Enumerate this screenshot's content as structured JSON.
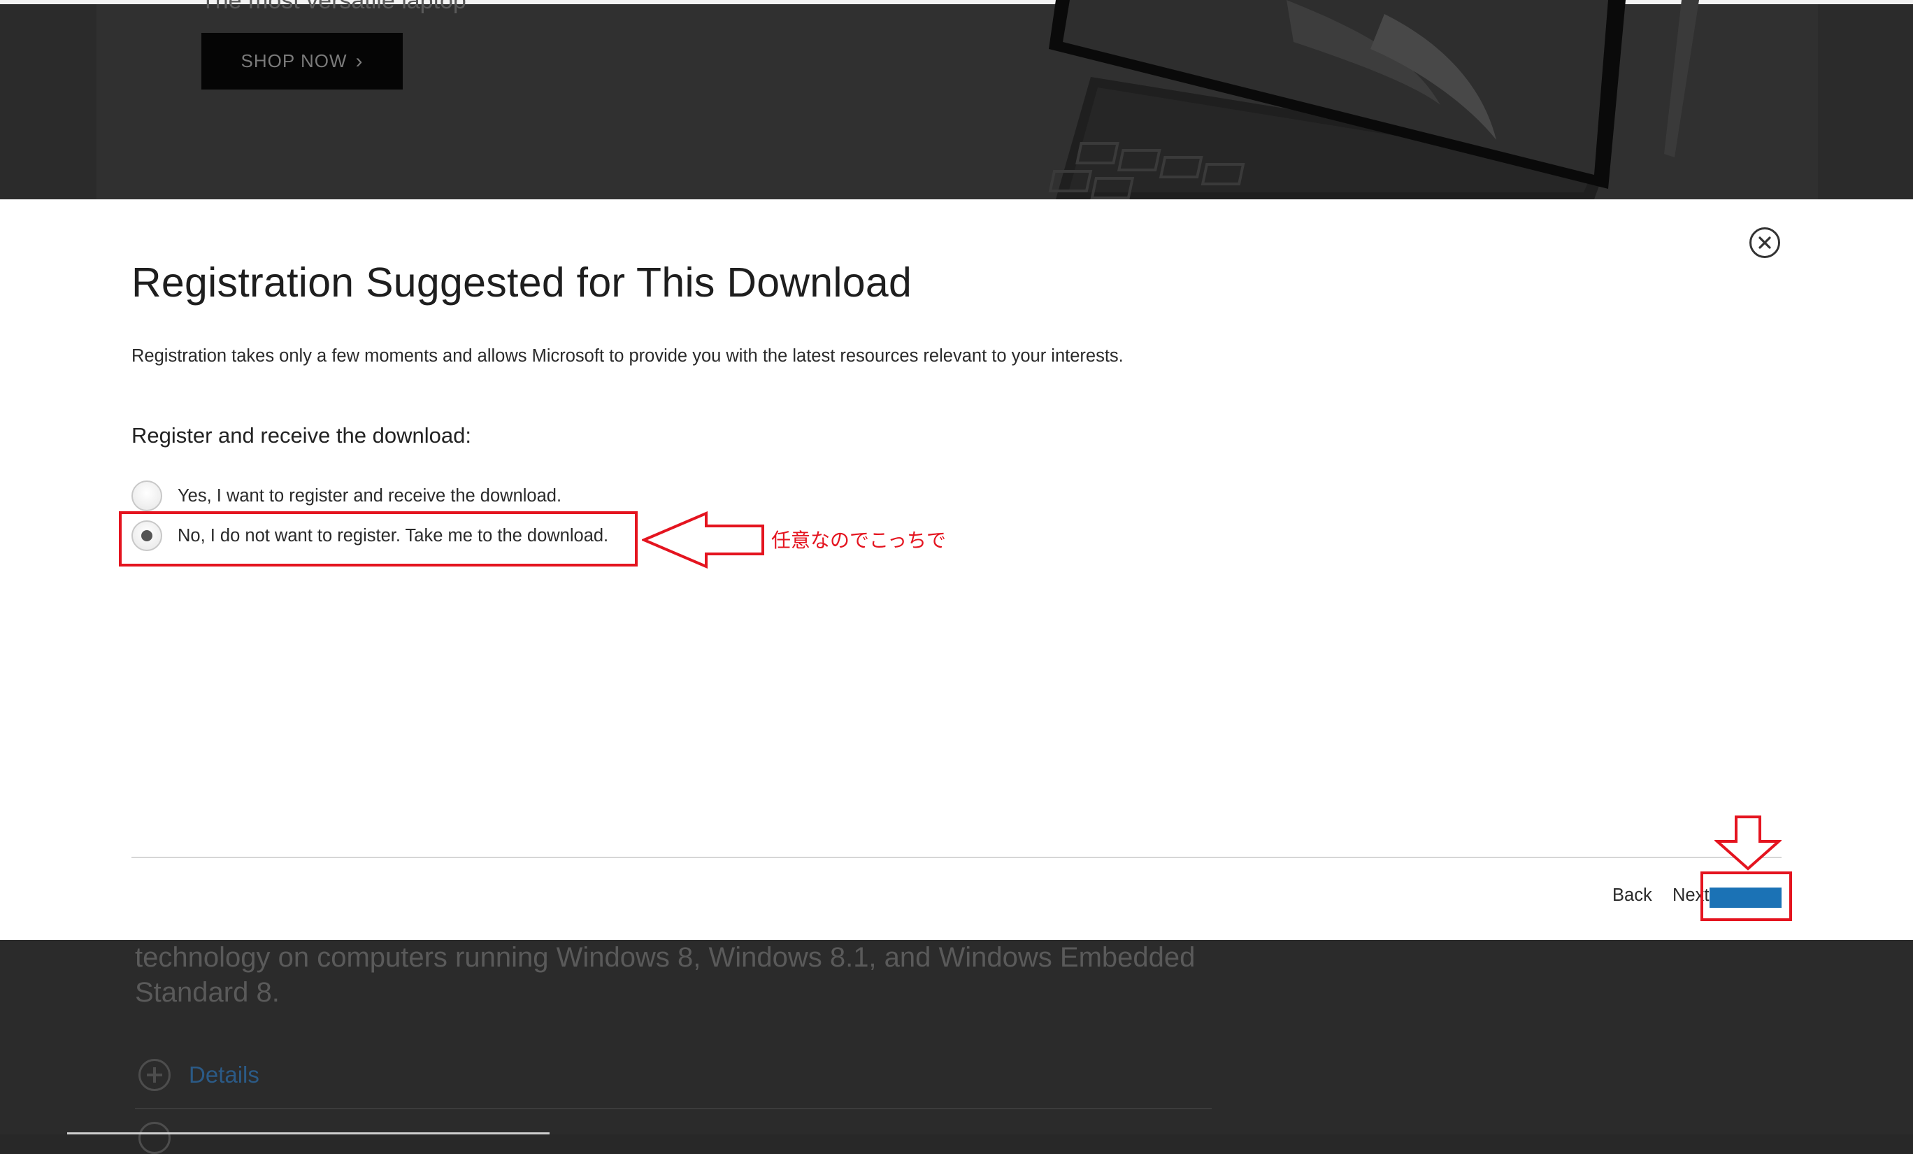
{
  "background": {
    "hero_tagline": "The most versatile laptop",
    "shop_now_label": "SHOP NOW",
    "description": "technology on computers running Windows 8, Windows 8.1, and Windows Embedded Standard 8.",
    "details_label": "Details"
  },
  "dialog": {
    "title": "Registration Suggested for This Download",
    "description": "Registration takes only a few moments and allows Microsoft to provide you with the latest resources relevant to your interests.",
    "section_label": "Register and receive the download:",
    "options": [
      {
        "label": "Yes, I want to register and receive the download.",
        "selected": false
      },
      {
        "label": "No, I do not want to register. Take me to the download.",
        "selected": true
      }
    ],
    "footer": {
      "back_label": "Back",
      "next_label": "Next"
    },
    "accent_color": "#1b72b5"
  },
  "annotations": {
    "note": "任意なのでこっちで",
    "color": "#e4141f"
  },
  "icons": [
    "close-icon",
    "chevron-right-icon",
    "plus-circle-icon",
    "arrow-left-icon",
    "arrow-down-icon"
  ]
}
